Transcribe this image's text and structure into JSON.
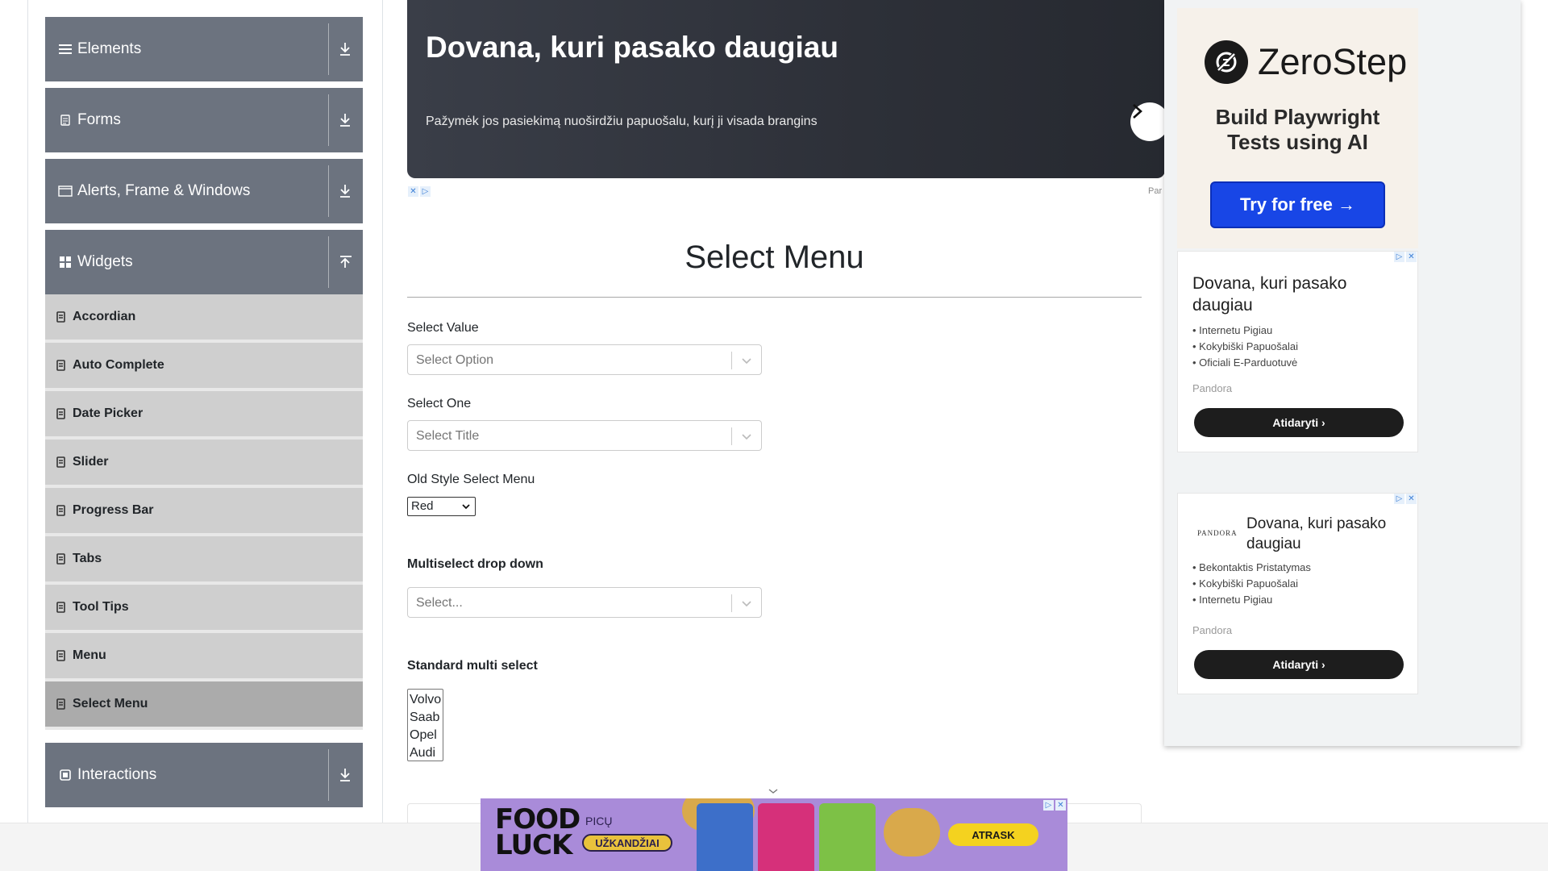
{
  "sidebar": {
    "groups": [
      {
        "label": "Elements",
        "icon": "hamburger-icon",
        "state": "collapsed"
      },
      {
        "label": "Forms",
        "icon": "form-icon",
        "state": "collapsed"
      },
      {
        "label": "Alerts, Frame & Windows",
        "icon": "window-icon",
        "state": "collapsed"
      },
      {
        "label": "Widgets",
        "icon": "grid-icon",
        "state": "expanded"
      },
      {
        "label": "Interactions",
        "icon": "interactions-icon",
        "state": "collapsed"
      }
    ],
    "widget_items": [
      "Accordian",
      "Auto Complete",
      "Date Picker",
      "Slider",
      "Progress Bar",
      "Tabs",
      "Tool Tips",
      "Menu",
      "Select Menu"
    ],
    "active_item": "Select Menu"
  },
  "banner_ad": {
    "title": "Dovana, kuri pasako daugiau",
    "subtitle": "Pažymėk jos pasiekimą nuoširdžiu papuošalu, kurį ji visada brangins",
    "source": "Par"
  },
  "main": {
    "title": "Select Menu",
    "select_value": {
      "label": "Select Value",
      "placeholder": "Select Option"
    },
    "select_one": {
      "label": "Select One",
      "placeholder": "Select Title"
    },
    "old_style": {
      "label": "Old Style Select Menu",
      "selected": "Red"
    },
    "multiselect": {
      "label": "Multiselect drop down",
      "placeholder": "Select..."
    },
    "standard_multi": {
      "label": "Standard multi select",
      "options": [
        "Volvo",
        "Saab",
        "Opel",
        "Audi"
      ]
    }
  },
  "right_ads": {
    "zerostep": {
      "brand": "ZeroStep",
      "line1": "Build Playwright",
      "line2": "Tests using AI",
      "cta": "Try for free →",
      "bg": "#f6f1ea",
      "button_color": "#1846e6"
    },
    "pandora1": {
      "title": "Dovana, kuri pasako daugiau",
      "bullets": [
        "Internetu Pigiau",
        "Kokybiški Papuošalai",
        "Oficiali E-Parduotuvė"
      ],
      "brand": "Pandora",
      "cta": "Atidaryti ›"
    },
    "pandora2": {
      "logo": "PANDORA",
      "title": "Dovana, kuri pasako daugiau",
      "bullets": [
        "Bekontaktis Pristatymas",
        "Kokybiški Papuošalai",
        "Internetu Pigiau"
      ],
      "brand": "Pandora",
      "cta": "Atidaryti ›"
    }
  },
  "bottom_ad": {
    "logo_line1": "FOOD",
    "logo_line2": "LUCK",
    "tag1": "PICŲ",
    "tag2": "UŽKANDŽIAI",
    "cta": "ATRASK",
    "bg": "#a98bd9"
  },
  "colors": {
    "sidebar_group": "#6c737f",
    "sidebar_item": "#cfcfcf",
    "sidebar_active": "#ababab"
  }
}
